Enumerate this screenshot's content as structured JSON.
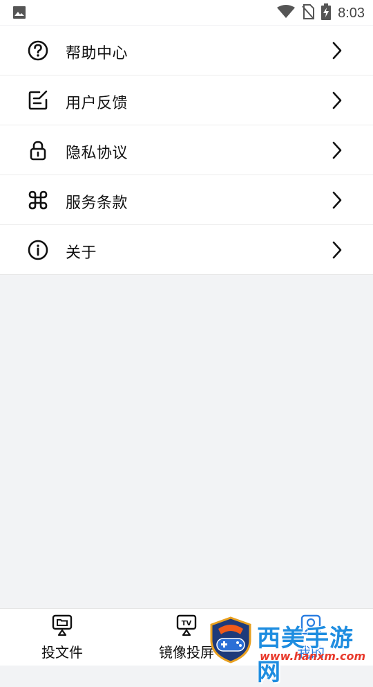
{
  "status_bar": {
    "time": "8:03",
    "icons": [
      "image-icon",
      "wifi-icon",
      "no-sim-icon",
      "battery-charging-icon"
    ]
  },
  "menu": {
    "items": [
      {
        "label": "帮助中心",
        "icon": "help-circle-icon"
      },
      {
        "label": "用户反馈",
        "icon": "feedback-edit-icon"
      },
      {
        "label": "隐私协议",
        "icon": "lock-icon"
      },
      {
        "label": "服务条款",
        "icon": "command-icon"
      },
      {
        "label": "关于",
        "icon": "info-circle-icon"
      }
    ]
  },
  "tabbar": {
    "tabs": [
      {
        "label": "投文件",
        "icon": "cast-file-icon",
        "active": false
      },
      {
        "label": "镜像投屏",
        "icon": "tv-cast-icon",
        "active": false
      },
      {
        "label": "我的",
        "icon": "profile-icon",
        "active": true
      }
    ]
  },
  "watermark": {
    "title": "西美手游网",
    "url": "www.hanxm.com"
  },
  "colors": {
    "background": "#f2f3f5",
    "active_tab": "#2a7de1",
    "watermark_title": "#1e8de0",
    "watermark_url": "#e83a2c"
  }
}
